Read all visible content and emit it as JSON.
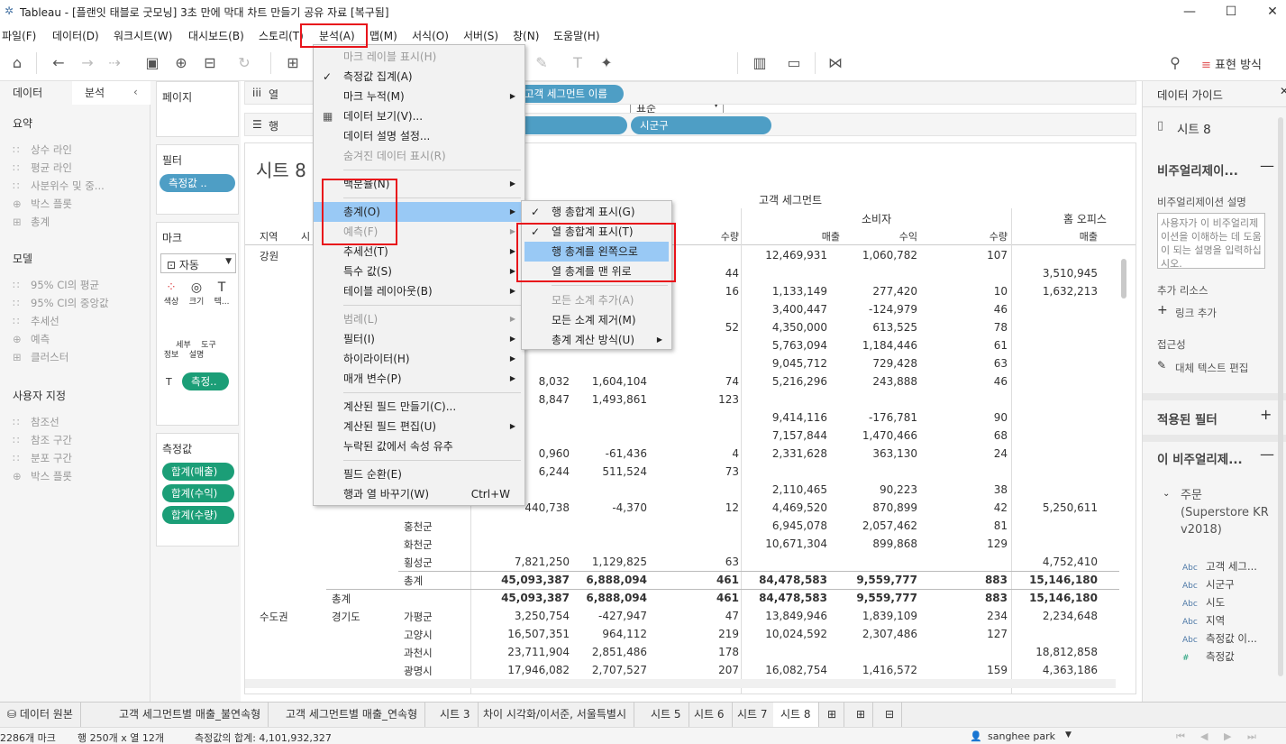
{
  "window": {
    "title": "Tableau - [플랜잇 태블로 굿모닝] 3초 만에 막대 차트 만들기 공유 자료 [복구됨]"
  },
  "menubar": [
    "파일(F)",
    "데이터(D)",
    "워크시트(W)",
    "대시보드(B)",
    "스토리(T)",
    "분석(A)",
    "맵(M)",
    "서식(O)",
    "서버(S)",
    "창(N)",
    "도움말(H)"
  ],
  "toolbar": {
    "standard": "표준",
    "show_me": "표현 방식"
  },
  "left_pane": {
    "tabs": [
      "데이터",
      "분석"
    ],
    "sections": [
      {
        "title": "요약",
        "items": [
          "상수 라인",
          "평균 라인",
          "사분위수 및 중...",
          "박스 플롯",
          "총계"
        ]
      },
      {
        "title": "모델",
        "items": [
          "95% CI의 평균",
          "95% CI의 중앙값",
          "추세선",
          "예측",
          "클러스터"
        ]
      },
      {
        "title": "사용자 지정",
        "items": [
          "참조선",
          "참조 구간",
          "분포 구간",
          "박스 플롯"
        ]
      }
    ]
  },
  "mid_pane": {
    "pages": "페이지",
    "filters": "필터",
    "filter_pill": "측정값 ..",
    "marks": "마크",
    "mark_type": "자동",
    "mark_buttons": [
      "색상",
      "크기",
      "텍...",
      "세부\n정보",
      "도구\n설명"
    ],
    "marks_pill": "측정..",
    "measures": "측정값",
    "measure_pills": [
      "합계(매출)",
      "합계(수익)",
      "합계(수량)"
    ]
  },
  "shelves": {
    "columns": "열",
    "rows": "행",
    "col_pill": "고객 세그먼트 이름",
    "row_pill": "시군구"
  },
  "sheet": {
    "title": "시트 8",
    "headers": {
      "segment_label": "고객 세그먼트",
      "consumer": "소비자",
      "home_office": "홈 오피스",
      "region": "지역",
      "province_abbr": "시",
      "sales": "매출",
      "profit": "수익",
      "qty": "수량"
    },
    "rows": [
      {
        "region": "강원",
        "sido": "",
        "gu": "",
        "c_sales": "",
        "c_profit": "",
        "c_qty": "",
        "s_sales": "12,469,931",
        "s_profit": "1,060,782",
        "s_qty": "107",
        "h_sales": ""
      },
      {
        "region": "",
        "sido": "",
        "gu": "",
        "c_sales": "",
        "c_profit": "",
        "c_qty": "44",
        "s_sales": "",
        "s_profit": "",
        "s_qty": "",
        "h_sales": "3,510,945"
      },
      {
        "region": "",
        "sido": "",
        "gu": "",
        "c_sales": "",
        "c_profit": "",
        "c_qty": "16",
        "s_sales": "1,133,149",
        "s_profit": "277,420",
        "s_qty": "10",
        "h_sales": "1,632,213"
      },
      {
        "region": "",
        "sido": "",
        "gu": "",
        "c_sales": "",
        "c_profit": "",
        "c_qty": "",
        "s_sales": "3,400,447",
        "s_profit": "-124,979",
        "s_qty": "46",
        "h_sales": ""
      },
      {
        "region": "",
        "sido": "",
        "gu": "",
        "c_sales": "",
        "c_profit": "",
        "c_qty": "52",
        "s_sales": "4,350,000",
        "s_profit": "613,525",
        "s_qty": "78",
        "h_sales": ""
      },
      {
        "region": "",
        "sido": "",
        "gu": "",
        "c_sales": "",
        "c_profit": "",
        "c_qty": "",
        "s_sales": "5,763,094",
        "s_profit": "1,184,446",
        "s_qty": "61",
        "h_sales": ""
      },
      {
        "region": "",
        "sido": "",
        "gu": "",
        "c_sales": "",
        "c_profit": "",
        "c_qty": "",
        "s_sales": "9,045,712",
        "s_profit": "729,428",
        "s_qty": "63",
        "h_sales": ""
      },
      {
        "region": "",
        "sido": "",
        "gu": "",
        "c_sales": "8,032",
        "c_profit": "1,604,104",
        "c_qty": "74",
        "s_sales": "5,216,296",
        "s_profit": "243,888",
        "s_qty": "46",
        "h_sales": ""
      },
      {
        "region": "",
        "sido": "",
        "gu": "",
        "c_sales": "8,847",
        "c_profit": "1,493,861",
        "c_qty": "123",
        "s_sales": "",
        "s_profit": "",
        "s_qty": "",
        "h_sales": ""
      },
      {
        "region": "",
        "sido": "",
        "gu": "",
        "c_sales": "",
        "c_profit": "",
        "c_qty": "",
        "s_sales": "9,414,116",
        "s_profit": "-176,781",
        "s_qty": "90",
        "h_sales": ""
      },
      {
        "region": "",
        "sido": "",
        "gu": "",
        "c_sales": "",
        "c_profit": "",
        "c_qty": "",
        "s_sales": "7,157,844",
        "s_profit": "1,470,466",
        "s_qty": "68",
        "h_sales": ""
      },
      {
        "region": "",
        "sido": "",
        "gu": "",
        "c_sales": "0,960",
        "c_profit": "-61,436",
        "c_qty": "4",
        "s_sales": "2,331,628",
        "s_profit": "363,130",
        "s_qty": "24",
        "h_sales": ""
      },
      {
        "region": "",
        "sido": "",
        "gu": "",
        "c_sales": "6,244",
        "c_profit": "511,524",
        "c_qty": "73",
        "s_sales": "",
        "s_profit": "",
        "s_qty": "",
        "h_sales": ""
      },
      {
        "region": "",
        "sido": "",
        "gu": "",
        "c_sales": "",
        "c_profit": "",
        "c_qty": "",
        "s_sales": "2,110,465",
        "s_profit": "90,223",
        "s_qty": "38",
        "h_sales": ""
      },
      {
        "region": "",
        "sido": "",
        "gu": "",
        "c_sales": "440,738",
        "c_profit": "-4,370",
        "c_qty": "12",
        "s_sales": "4,469,520",
        "s_profit": "870,899",
        "s_qty": "42",
        "h_sales": "5,250,611"
      },
      {
        "region": "",
        "sido": "",
        "gu": "홍천군",
        "c_sales": "",
        "c_profit": "",
        "c_qty": "",
        "s_sales": "6,945,078",
        "s_profit": "2,057,462",
        "s_qty": "81",
        "h_sales": ""
      },
      {
        "region": "",
        "sido": "",
        "gu": "화천군",
        "c_sales": "",
        "c_profit": "",
        "c_qty": "",
        "s_sales": "10,671,304",
        "s_profit": "899,868",
        "s_qty": "129",
        "h_sales": ""
      },
      {
        "region": "",
        "sido": "",
        "gu": "횡성군",
        "c_sales": "7,821,250",
        "c_profit": "1,129,825",
        "c_qty": "63",
        "s_sales": "",
        "s_profit": "",
        "s_qty": "",
        "h_sales": "4,752,410"
      },
      {
        "region": "",
        "sido": "",
        "gu": "총계",
        "c_sales": "45,093,387",
        "c_profit": "6,888,094",
        "c_qty": "461",
        "s_sales": "84,478,583",
        "s_profit": "9,559,777",
        "s_qty": "883",
        "h_sales": "15,146,180",
        "bold": true
      },
      {
        "region": "",
        "sido": "총계",
        "gu": "",
        "c_sales": "45,093,387",
        "c_profit": "6,888,094",
        "c_qty": "461",
        "s_sales": "84,478,583",
        "s_profit": "9,559,777",
        "s_qty": "883",
        "h_sales": "15,146,180",
        "bold": true
      },
      {
        "region": "수도권",
        "sido": "경기도",
        "gu": "가평군",
        "c_sales": "3,250,754",
        "c_profit": "-427,947",
        "c_qty": "47",
        "s_sales": "13,849,946",
        "s_profit": "1,839,109",
        "s_qty": "234",
        "h_sales": "2,234,648"
      },
      {
        "region": "",
        "sido": "",
        "gu": "고양시",
        "c_sales": "16,507,351",
        "c_profit": "964,112",
        "c_qty": "219",
        "s_sales": "10,024,592",
        "s_profit": "2,307,486",
        "s_qty": "127",
        "h_sales": ""
      },
      {
        "region": "",
        "sido": "",
        "gu": "과천시",
        "c_sales": "23,711,904",
        "c_profit": "2,851,486",
        "c_qty": "178",
        "s_sales": "",
        "s_profit": "",
        "s_qty": "",
        "h_sales": "18,812,858"
      },
      {
        "region": "",
        "sido": "",
        "gu": "광명시",
        "c_sales": "17,946,082",
        "c_profit": "2,707,527",
        "c_qty": "207",
        "s_sales": "16,082,754",
        "s_profit": "1,416,572",
        "s_qty": "159",
        "h_sales": "4,363,186"
      }
    ]
  },
  "analysis_menu": [
    {
      "label": "마크 레이블 표시(H)",
      "disabled": true
    },
    {
      "label": "측정값 집계(A)",
      "checked": true
    },
    {
      "label": "마크 누적(M)",
      "sub": true
    },
    {
      "label": "데이터 보기(V)..."
    },
    {
      "label": "데이터 설명 설정..."
    },
    {
      "label": "숨겨진 데이터 표시(R)",
      "disabled": true
    },
    {
      "sep": true
    },
    {
      "label": "백분율(N)",
      "sub": true
    },
    {
      "sep": true
    },
    {
      "label": "총계(O)",
      "sub": true,
      "highlight": true
    },
    {
      "label": "예측(F)",
      "sub": true,
      "disabled": true
    },
    {
      "label": "추세선(T)",
      "sub": true
    },
    {
      "label": "특수 값(S)",
      "sub": true
    },
    {
      "label": "테이블 레이아웃(B)",
      "sub": true
    },
    {
      "sep": true
    },
    {
      "label": "범례(L)",
      "sub": true,
      "disabled": true
    },
    {
      "label": "필터(I)",
      "sub": true
    },
    {
      "label": "하이라이터(H)",
      "sub": true
    },
    {
      "label": "매개 변수(P)",
      "sub": true
    },
    {
      "sep": true
    },
    {
      "label": "계산된 필드 만들기(C)..."
    },
    {
      "label": "계산된 필드 편집(U)",
      "sub": true
    },
    {
      "label": "누락된 값에서 속성 유추"
    },
    {
      "sep": true
    },
    {
      "label": "필드 순환(E)"
    },
    {
      "label": "행과 열 바꾸기(W)",
      "shortcut": "Ctrl+W"
    }
  ],
  "totals_menu": [
    {
      "label": "행 총합계 표시(G)",
      "checked": true
    },
    {
      "label": "열 총합계 표시(T)",
      "checked": true
    },
    {
      "label": "행 총계를 왼쪽으로",
      "highlight": true
    },
    {
      "label": "열 총계를 맨 위로"
    },
    {
      "sep": true
    },
    {
      "label": "모든 소계 추가(A)",
      "disabled": true
    },
    {
      "label": "모든 소계 제거(M)"
    },
    {
      "label": "총계 계산 방식(U)",
      "sub": true
    }
  ],
  "right_pane": {
    "title": "데이터 가이드",
    "sheet": "시트 8",
    "viz_section": "비주얼리제이...",
    "viz_desc_label": "비주얼리제이션 설명",
    "viz_desc_placeholder": "사용자가 이 비주얼리제이션을 이해하는 데 도움이 되는 설명을 입력하십시오.",
    "resources": "추가 리소스",
    "add_link": "링크 추가",
    "accessibility": "접근성",
    "alt_text": "대체 텍스트 편집",
    "applied_filters": "적용된 필터",
    "this_viz": "이 비주얼리제...",
    "datasource": "주문 (Superstore KR v2018)",
    "fields": [
      "고객 세그...",
      "시군구",
      "시도",
      "지역",
      "측정값 이...",
      "측정값"
    ]
  },
  "tabs": [
    "데이터 원본",
    "고객 세그먼트별 매출_불연속형",
    "고객 세그먼트별 매출_연속형",
    "시트 3",
    "차이 시각화/이서준, 서울특별시",
    "시트 5",
    "시트 6",
    "시트 7",
    "시트 8"
  ],
  "status": {
    "marks": "2286개 마크",
    "rows_cols": "행 250개 x 열 12개",
    "sum": "측정값의 합계: 4,101,932,327",
    "user": "sanghee park"
  },
  "colors": {
    "pill_green": "#1b9e77",
    "pill_blue": "#4e9ec5",
    "highlight": "#99c9f5",
    "annotation_red": "#e8141b"
  }
}
